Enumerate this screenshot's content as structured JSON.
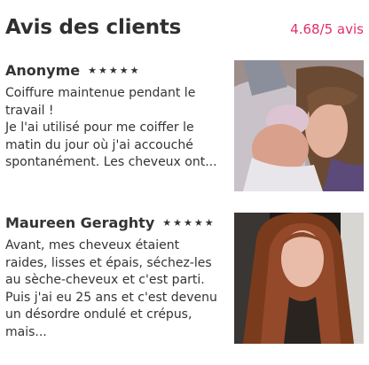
{
  "header": {
    "title": "Avis des clients",
    "rating": "4.68/5 avis"
  },
  "reviews": [
    {
      "name": "Anonyme",
      "stars": 5,
      "text": "Coiffure maintenue pendant le travail !\nJe l'ai utilisé pour me coiffer le matin du jour où j'ai accouché spontanément. Les cheveux ont..."
    },
    {
      "name": "Maureen Geraghty",
      "stars": 5,
      "text": "Avant, mes cheveux étaient raides, lisses et épais, séchez-les au sèche-cheveux et c'est parti. Puis j'ai eu 25 ans et c'est devenu un désordre ondulé et crépus, mais..."
    }
  ],
  "colors": {
    "accent": "#e0306a",
    "text": "#333333"
  },
  "icons": {
    "star": "star-icon"
  }
}
